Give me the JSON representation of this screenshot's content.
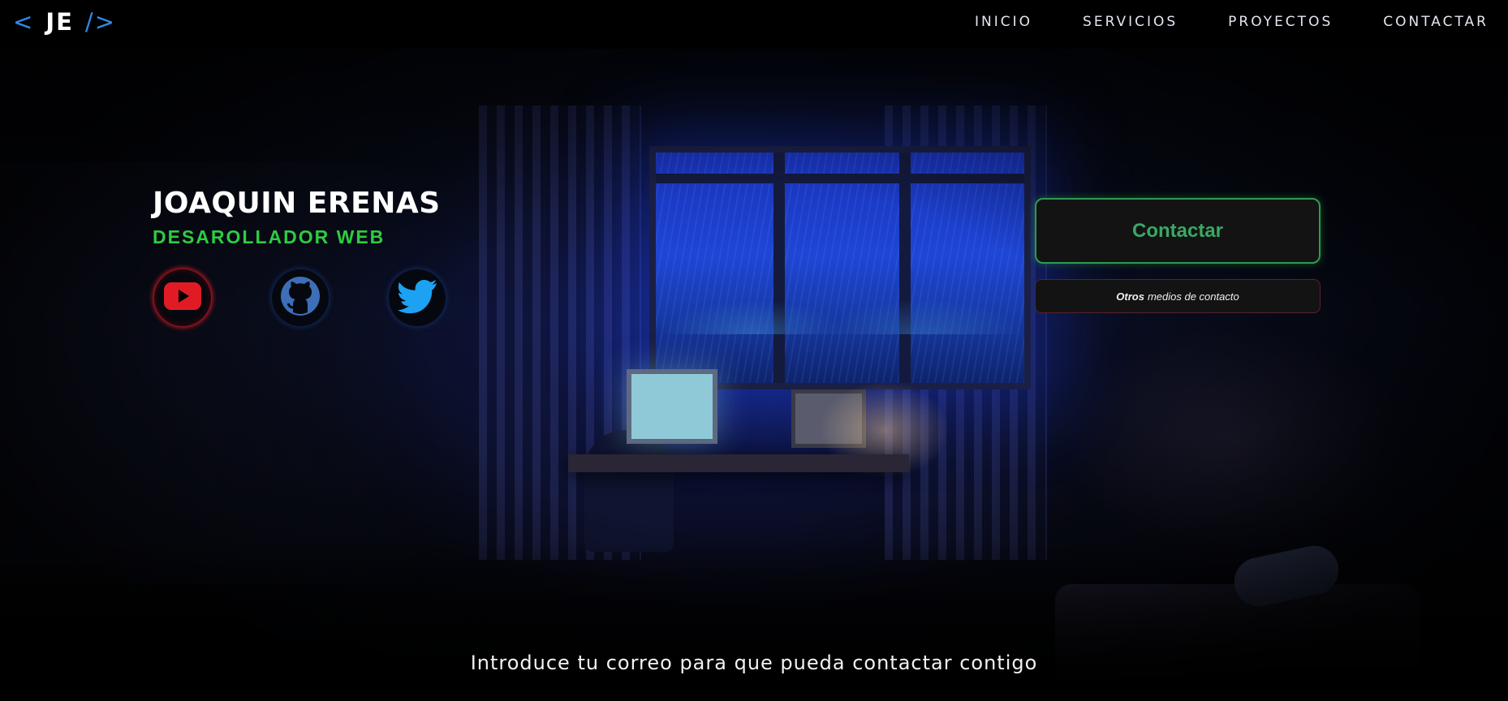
{
  "logo": {
    "open": "<",
    "initials": "JE",
    "close": "/>"
  },
  "nav": {
    "items": [
      "INICIO",
      "SERVICIOS",
      "PROYECTOS",
      "CONTACTAR"
    ]
  },
  "hero": {
    "name": "JOAQUIN ERENAS",
    "role": "DESAROLLADOR WEB",
    "social": [
      {
        "icon": "youtube-icon"
      },
      {
        "icon": "github-icon"
      },
      {
        "icon": "twitter-icon"
      }
    ],
    "contact_button": "Contactar",
    "other_contact": {
      "bold": "Otros",
      "rest": "medios de contacto"
    }
  },
  "email_prompt": "Introduce tu correo para que pueda contactar contigo",
  "colors": {
    "accent_blue": "#2c8be8",
    "accent_green": "#2ecc40",
    "youtube_red": "#e01b24",
    "github_blue": "#3d6fb8",
    "twitter_blue": "#1da1f2"
  }
}
